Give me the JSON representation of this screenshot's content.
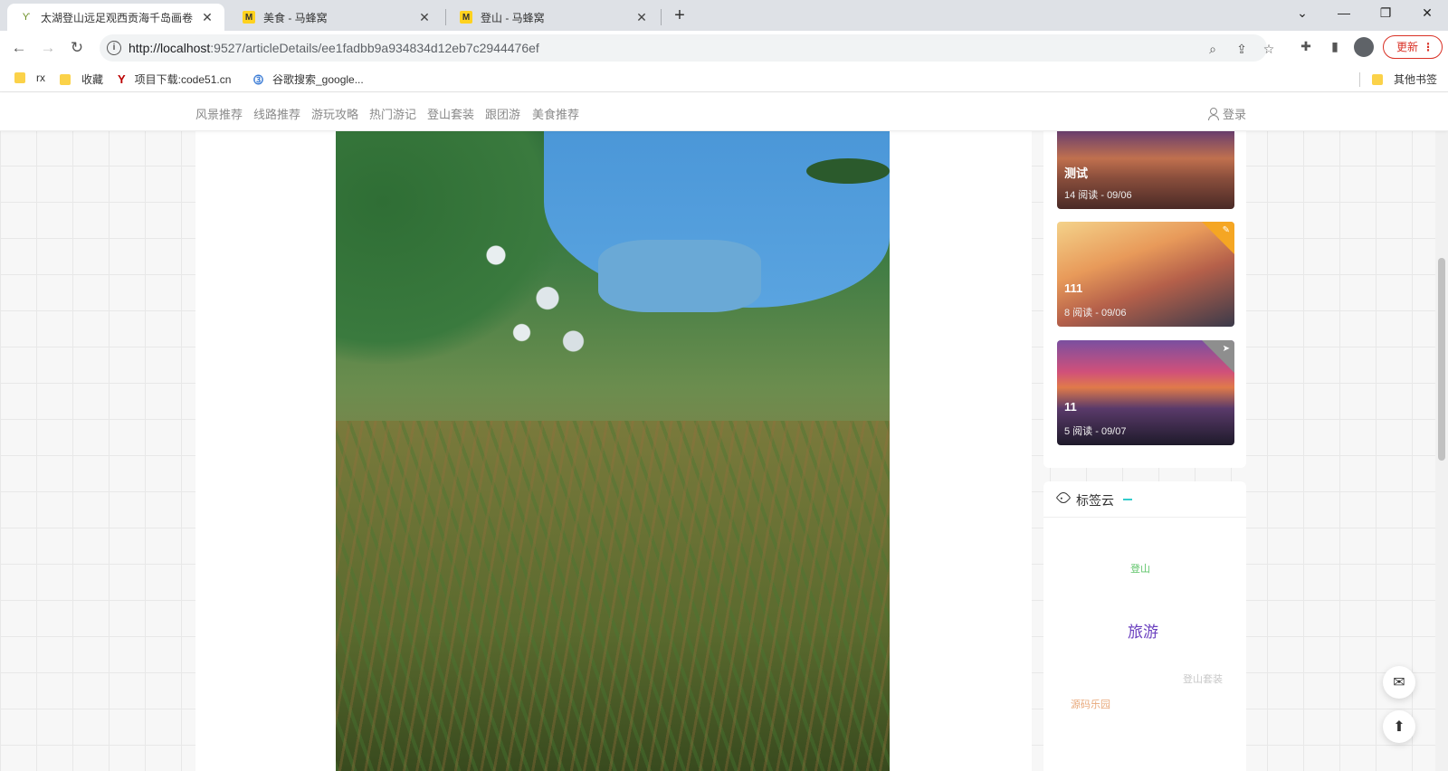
{
  "browser": {
    "tabs": [
      {
        "title": "太湖登山远足观西贡海千岛画卷",
        "favicon": "sprout-icon"
      },
      {
        "title": "美食 - 马蜂窝",
        "favicon": "mafengwo-icon"
      },
      {
        "title": "登山 - 马蜂窝",
        "favicon": "mafengwo-icon"
      }
    ],
    "url_host": "http://localhost",
    "url_path": ":9527/articleDetails/ee1fadbb9a934834d12eb7c2944476ef",
    "update_label": "更新",
    "bookmarks": [
      "rx",
      "收藏",
      "项目下载:code51.cn",
      "谷歌搜索_google..."
    ],
    "other_bookmarks": "其他书签"
  },
  "site": {
    "nav": [
      "风景推荐",
      "线路推荐",
      "游玩攻略",
      "热门游记",
      "登山套装",
      "跟团游",
      "美食推荐"
    ],
    "login": "登录"
  },
  "recommend": [
    {
      "title": "测试",
      "meta": "14 阅读 - 09/06"
    },
    {
      "title": "111",
      "meta": "8 阅读 - 09/06"
    },
    {
      "title": "11",
      "meta": "5 阅读 - 09/07"
    }
  ],
  "tag_cloud": {
    "title": "标签云",
    "tags": [
      {
        "text": "登山",
        "color": "#5fc46a"
      },
      {
        "text": "旅游",
        "color": "#6a3fbf"
      },
      {
        "text": "登山套装",
        "color": "#c8c8c8"
      },
      {
        "text": "源码乐园",
        "color": "#e8a87a"
      }
    ]
  },
  "colors": {
    "accent_update": "#d93025",
    "nav_text": "#8a8a8a",
    "corner_badge_orange": "#f5a623",
    "corner_badge_gray": "#8e8e8e"
  }
}
